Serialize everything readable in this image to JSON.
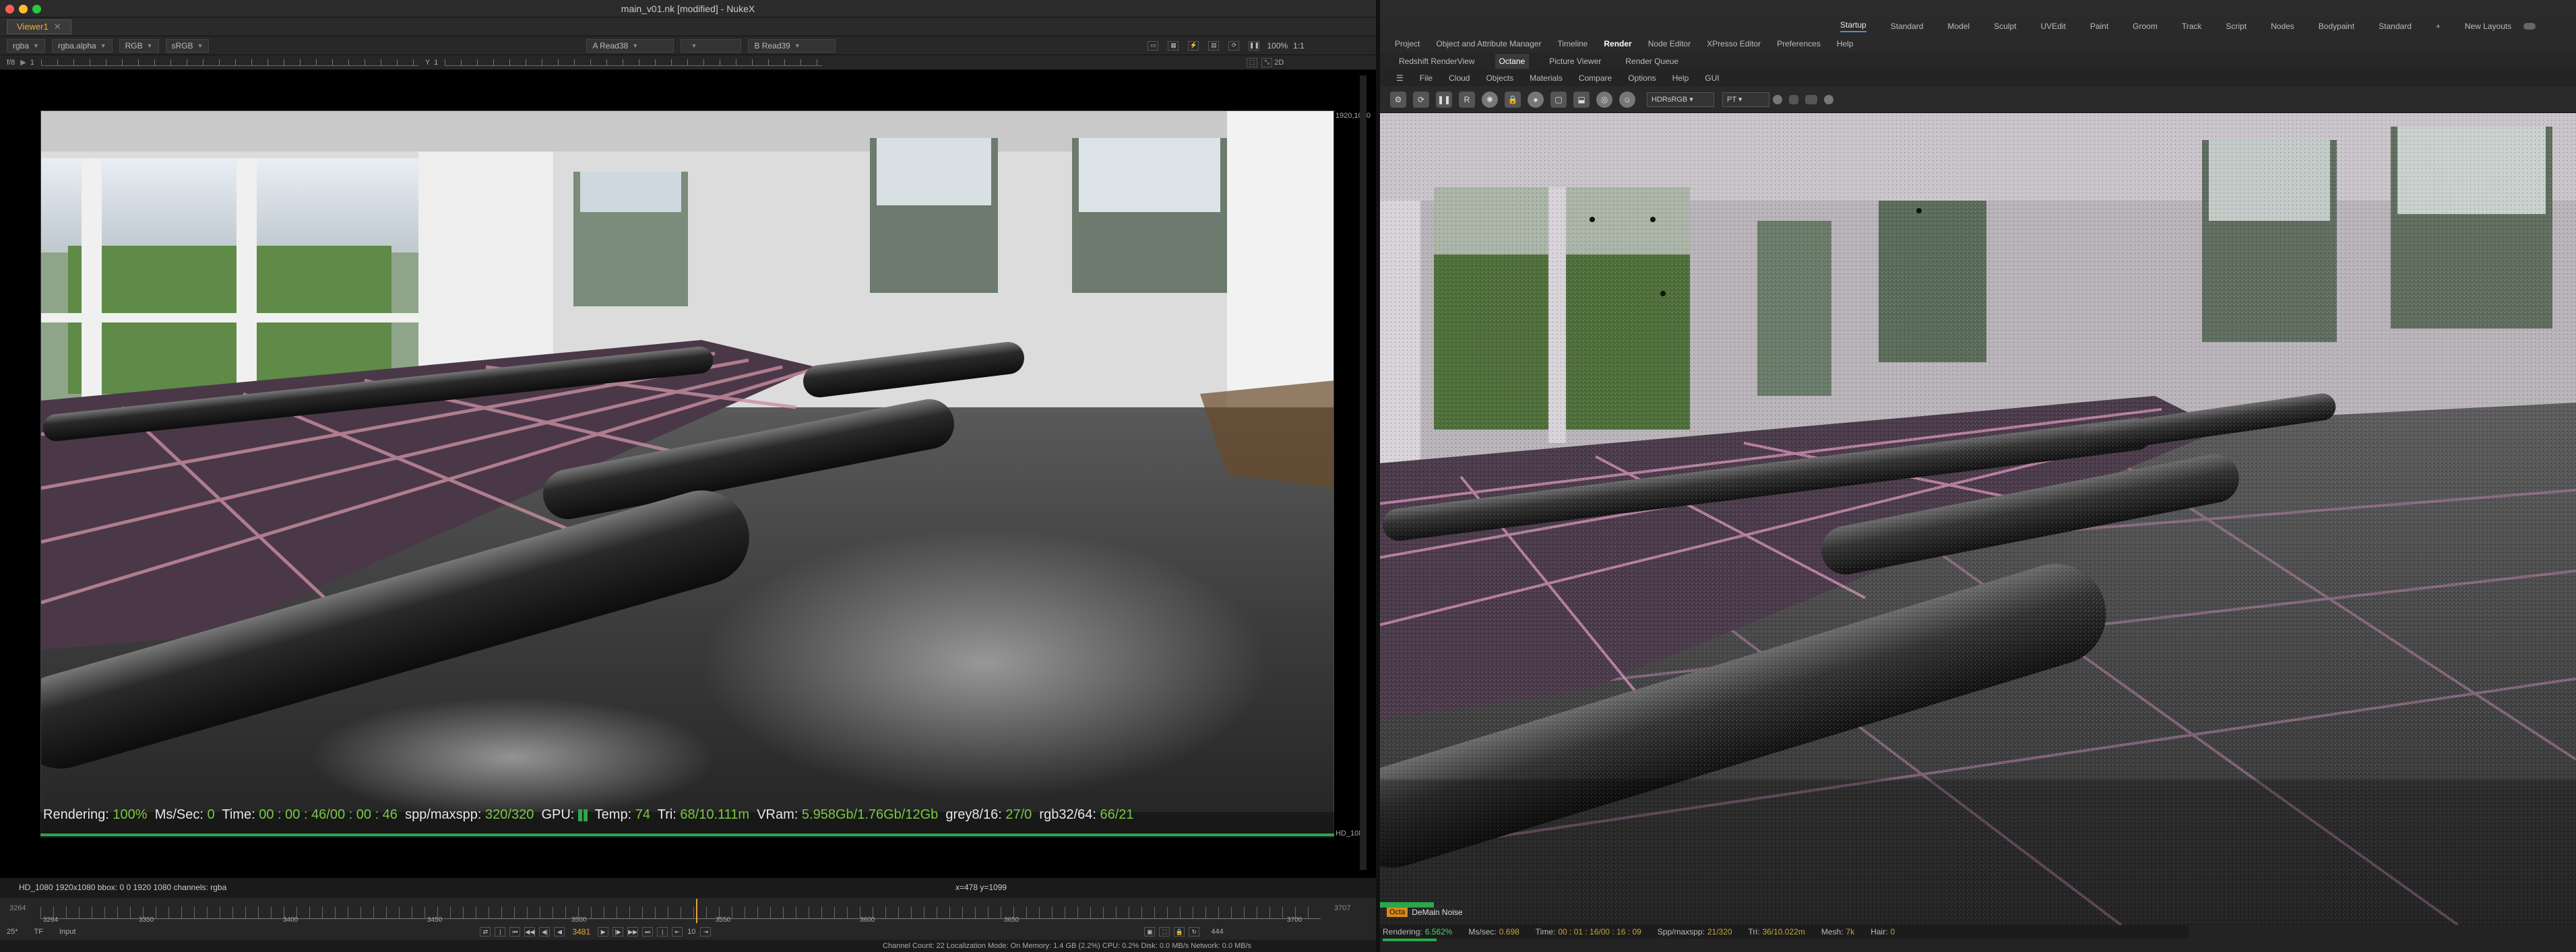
{
  "nuke": {
    "window_title": "main_v01.nk [modified] - NukeX",
    "viewer_tab": "Viewer1",
    "channels": "rgba",
    "layer": "rgba.alpha",
    "colorspace_channel": "RGB",
    "colorspace": "sRGB",
    "input_a": "A  Read38",
    "input_b": "B  Read39",
    "zoom": "100%",
    "ratio": "1:1",
    "mode_2d": "2D",
    "ruler_left": "f/8",
    "ruler_frame": "1",
    "ruler_y": "Y",
    "ruler_y_val": "1",
    "res_top_right": "1920,1080",
    "res_bottom_right": "HD_1080",
    "hud": {
      "rendering_label": "Rendering:",
      "rendering_value": "100%",
      "ms_label": "Ms/Sec:",
      "ms_value": "0",
      "time_label": "Time:",
      "time_value": "00 : 00 : 46/00 : 00 : 46",
      "spp_label": "spp/maxspp:",
      "spp_value": "320/320",
      "gpu_label": "GPU:",
      "temp_label": "Temp:",
      "temp_value": "74",
      "tri_label": "Tri:",
      "tri_value": "68/10.111m",
      "vram_label": "VRam:",
      "vram_value": "5.958Gb/1.76Gb/12Gb",
      "grey_label": "grey8/16:",
      "grey_value": "27/0",
      "rgb_label": "rgb32/64:",
      "rgb_value": "66/21"
    },
    "info_bar": "HD_1080 1920x1080  bbox: 0 0 1920 1080 channels: rgba",
    "coords": "x=478 y=1099",
    "timeline": {
      "start": "3264",
      "end": "3707",
      "ticks": [
        "3264",
        "3350",
        "3400",
        "3450",
        "3500",
        "3550",
        "3600",
        "3650",
        "3700"
      ],
      "current": "3481",
      "fps": "25*",
      "tf": "TF",
      "input": "Input",
      "step": "10",
      "end_field": "444"
    },
    "status": "Channel Count: 22  Localization Mode: On  Memory: 1.4 GB (2.2%)  CPU: 0.2%  Disk: 0.0 MB/s  Network: 0.0 MB/s"
  },
  "c4d": {
    "modes": [
      "Startup",
      "Standard",
      "Model",
      "Sculpt",
      "UVEdit",
      "Paint",
      "Groom",
      "Track",
      "Script",
      "Nodes",
      "Bodypaint",
      "Standard"
    ],
    "active_mode": "Startup",
    "new_layouts": "New Layouts",
    "menus": [
      "Project",
      "Object and Attribute Manager",
      "Timeline",
      "Render",
      "Node Editor",
      "XPresso Editor",
      "Preferences",
      "Help"
    ],
    "active_menu": "Render",
    "subtabs": [
      "Redshift RenderView",
      "Octane",
      "Picture Viewer",
      "Render Queue"
    ],
    "active_subtab": "Octane",
    "oct_menu": [
      "File",
      "Cloud",
      "Objects",
      "Materials",
      "Compare",
      "Options",
      "Help",
      "GUI"
    ],
    "colorspace_select": "HDRsRGB",
    "kernel_select": "PT",
    "denoise_chip": "Octa",
    "denoise_label": "DeMain Noise",
    "status": {
      "rendering_label": "Rendering:",
      "rendering_value": "6.562%",
      "ms_label": "Ms/sec:",
      "ms_value": "0.698",
      "time_label": "Time:",
      "time_value": "00 : 01 : 16/00 : 16 : 09",
      "spp_label": "Spp/maxspp:",
      "spp_value": "21/320",
      "tri_label": "Tri:",
      "tri_value": "36/10.022m",
      "mesh_label": "Mesh:",
      "mesh_value": "7k",
      "hair_label": "Hair:",
      "hair_value": "0"
    }
  },
  "colors": {
    "accent_orange": "#e8a33a",
    "accent_green": "#7ac943",
    "accent_blue": "#5a8ad8"
  }
}
